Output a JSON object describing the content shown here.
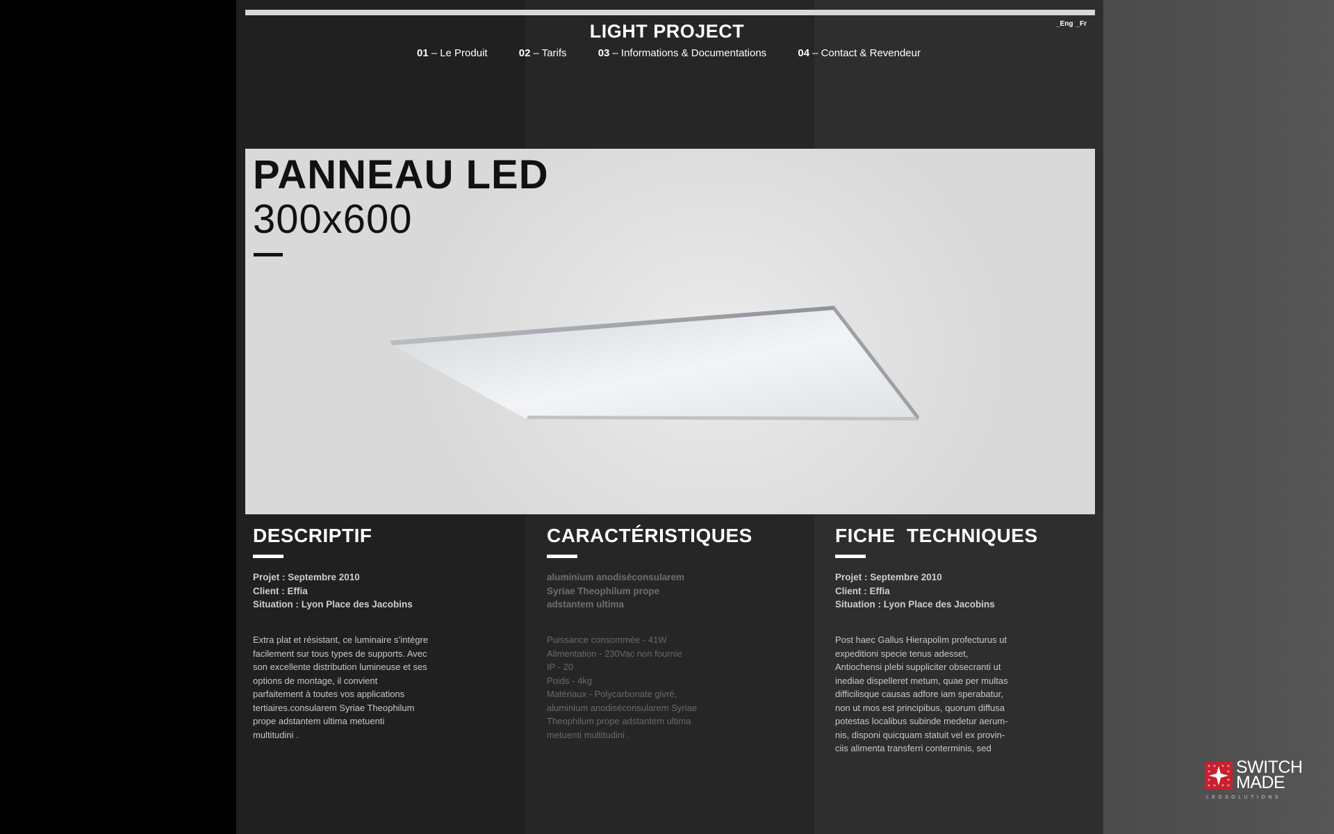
{
  "header": {
    "brand": "LIGHT PROJECT",
    "lang": [
      "_Eng",
      "_Fr"
    ],
    "nav": [
      {
        "num": "01",
        "label": "– Le Produit"
      },
      {
        "num": "02",
        "label": "– Tarifs"
      },
      {
        "num": "03",
        "label": "– Informations & Documentations"
      },
      {
        "num": "04",
        "label": "– Contact & Revendeur"
      }
    ]
  },
  "hero": {
    "title": "PANNEAU LED",
    "size": "300x600"
  },
  "sections": {
    "descriptif": {
      "title": "DESCRIPTIF",
      "meta": [
        "Projet : Septembre 2010",
        "Client : Effia",
        "Situation : Lyon Place des Jacobins"
      ],
      "body": [
        "Extra plat et résistant, ce luminaire s’intègre",
        "facilement sur tous types de supports. Avec",
        "son excellente distribution lumineuse et ses",
        "options de montage, il convient",
        "parfaitement à toutes vos applications",
        "tertiaires.consularem Syriae Theophilum",
        "prope adstantem ultima metuenti",
        "multitudini ."
      ]
    },
    "caracteristiques": {
      "title": "CARACTÉRISTIQUES",
      "meta": [
        "aluminium anodiséconsularem",
        "Syriae Theophilum prope",
        "adstantem ultima"
      ],
      "body": [
        "Puissance consommée - 41W",
        "Alimentation - 230Vac non fournie",
        "IP - 20",
        "Poids - 4kg",
        "Matériaux - Polycarbonate givré,",
        "aluminium anodiséconsularem Syriae",
        "Theophilum prope adstantem ultima",
        "metuenti multitudini ."
      ]
    },
    "fiche": {
      "title": "FICHE  TECHNIQUES",
      "meta": [
        "Projet : Septembre 2010",
        "Client : Effia",
        "Situation : Lyon Place des Jacobins"
      ],
      "body": [
        "Post haec Gallus Hierapolim profecturus ut",
        "expeditioni specie tenus adesset,",
        "Antiochensi plebi suppliciter obsecranti ut",
        "inediae dispelleret metum, quae per multas",
        "difficilisque causas adfore iam sperabatur,",
        "non ut mos est principibus, quorum diffusa",
        "potestas localibus subinde medetur aerum-",
        "nis, disponi quicquam statuit vel ex provin-",
        "ciis alimenta transferri conterminis, sed"
      ]
    }
  },
  "logo": {
    "line1": "SWITCH",
    "line2": "MADE",
    "sub": "LEDSOLUTIONS"
  },
  "colors": {
    "accent_logo": "#c8202f",
    "hero_bg": "#dcdcdc"
  }
}
